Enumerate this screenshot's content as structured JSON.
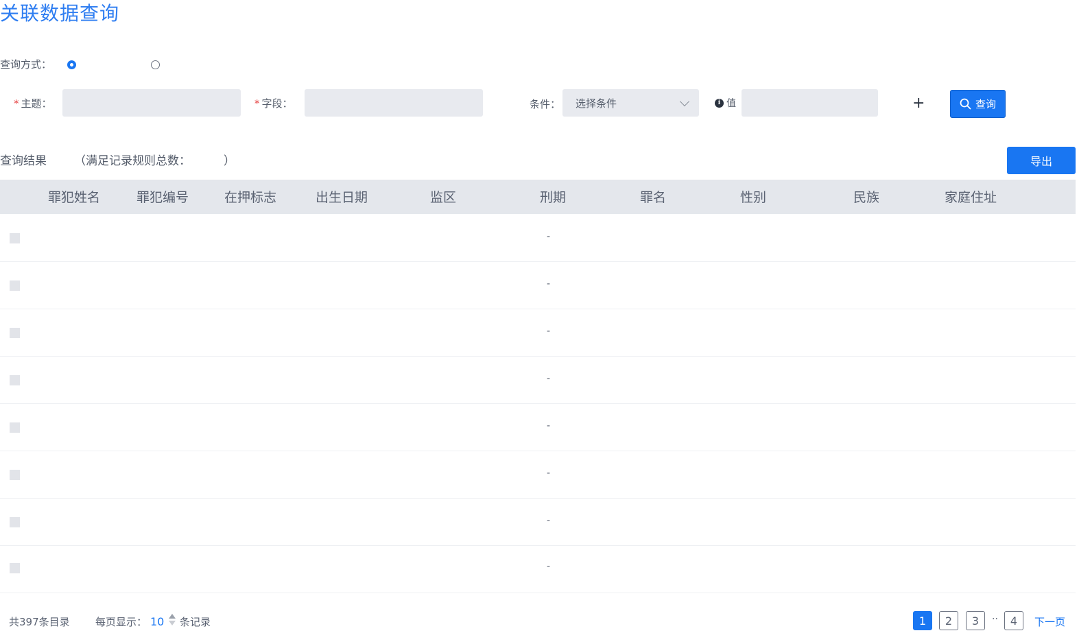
{
  "page_title": "关联数据查询",
  "query_mode": {
    "label": "查询方式：",
    "selected_index": 0
  },
  "filters": {
    "subject_label": "主题：",
    "field_label": "字段：",
    "condition_label": "条件：",
    "condition_value": "选择条件",
    "value_label": "值",
    "required_mark": "*",
    "add_symbol": "+",
    "query_button": "查询"
  },
  "results": {
    "title": "查询结果",
    "count_label": "（满足记录规则总数：",
    "count_close": "）",
    "export_button": "导出"
  },
  "table": {
    "columns": [
      "罪犯姓名",
      "罪犯编号",
      "在押标志",
      "出生日期",
      "监区",
      "刑期",
      "罪名",
      "性别",
      "民族",
      "家庭住址"
    ],
    "rows": [
      {
        "sentence": "-"
      },
      {
        "sentence": "-"
      },
      {
        "sentence": "-"
      },
      {
        "sentence": "-"
      },
      {
        "sentence": "-"
      },
      {
        "sentence": "-"
      },
      {
        "sentence": "-"
      },
      {
        "sentence": "-"
      }
    ]
  },
  "footer": {
    "total": "共397条目录",
    "per_page_label": "每页显示：",
    "per_page_value": "10",
    "records_label": "条记录",
    "pages": [
      "1",
      "2",
      "3",
      "4"
    ],
    "ellipsis": "··",
    "next": "下一页"
  },
  "colors": {
    "accent": "#1976f2",
    "title": "#2f7ef1",
    "header_bg": "#e4e7ec",
    "input_bg": "#e8eaef",
    "required": "#e64545"
  },
  "icons": [
    "search-icon",
    "info-icon",
    "chevron-down-icon",
    "plus-icon",
    "sort-arrows-icon"
  ]
}
